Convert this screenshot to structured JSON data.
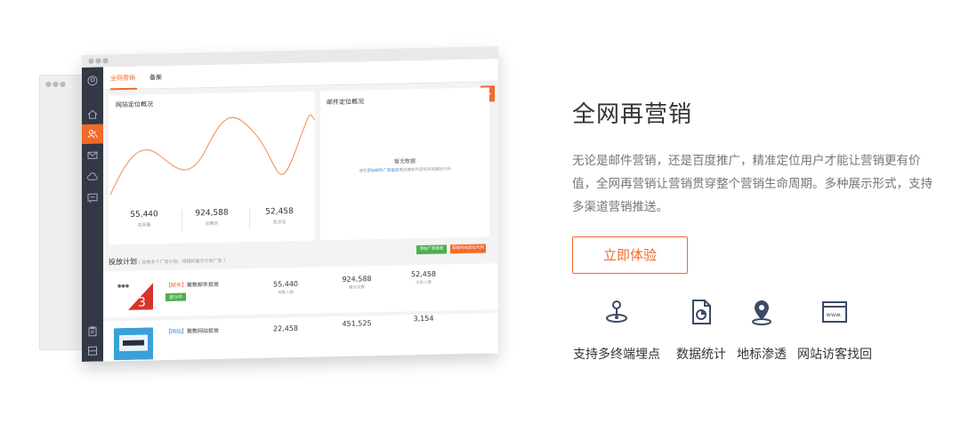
{
  "mockup": {
    "tabs": [
      "全网营销",
      "备案"
    ],
    "sidebar_icons": [
      "user-icon",
      "home-icon",
      "people-icon",
      "mail-icon",
      "cloud-icon",
      "message-icon",
      "clipboard-icon",
      "layout-icon"
    ],
    "overview_card": {
      "title": "网站定位概况",
      "stats": [
        {
          "value": "55,440",
          "label": "总采集"
        },
        {
          "value": "924,588",
          "label": "总展示"
        },
        {
          "value": "52,458",
          "label": "总点击"
        }
      ]
    },
    "email_card": {
      "title": "邮件定位概况",
      "empty_title": "暂无数据",
      "empty_desc_pre": "请先",
      "empty_desc_link": "添加邮件广告投放",
      "empty_desc_post": "再创建邮件营销添加跟踪代码"
    },
    "plan": {
      "title": "投放计划",
      "subtitle": "( 如有多个广告计划，将随机展示计划广告 )",
      "btn_add": "添加广告投放",
      "btn_code": "获取网站定位代码",
      "rows": [
        {
          "tag": "【邮件】",
          "name": "聚数邮件投放",
          "status": "进行中",
          "stats": [
            {
              "value": "55,440",
              "label": "采集人数"
            },
            {
              "value": "924,588",
              "label": "展示次数"
            },
            {
              "value": "52,458",
              "label": "点击人数"
            }
          ]
        },
        {
          "tag": "【网站】",
          "name": "聚数网站投放",
          "status": "",
          "stats": [
            {
              "value": "22,458",
              "label": ""
            },
            {
              "value": "451,525",
              "label": ""
            },
            {
              "value": "3,154",
              "label": ""
            }
          ]
        }
      ]
    }
  },
  "content": {
    "headline": "全网再营销",
    "description": "无论是邮件营销，还是百度推广，精准定位用户才能让营销更有价值，全网再营销让营销贯穿整个营销生命周期。多种展示形式，支持多渠道营销推送。",
    "cta": "立即体验",
    "features": [
      {
        "icon": "joystick-icon",
        "label": "支持多终端埋点"
      },
      {
        "icon": "report-chart-icon",
        "label": "数据统计"
      },
      {
        "icon": "map-pin-icon",
        "label": "地标渗透"
      },
      {
        "icon": "browser-window-icon",
        "label": "网站访客找回"
      }
    ]
  },
  "colors": {
    "accent": "#f26a2b",
    "sidebar": "#323844",
    "green": "#4caf50",
    "text": "#333333",
    "muted": "#777777"
  }
}
